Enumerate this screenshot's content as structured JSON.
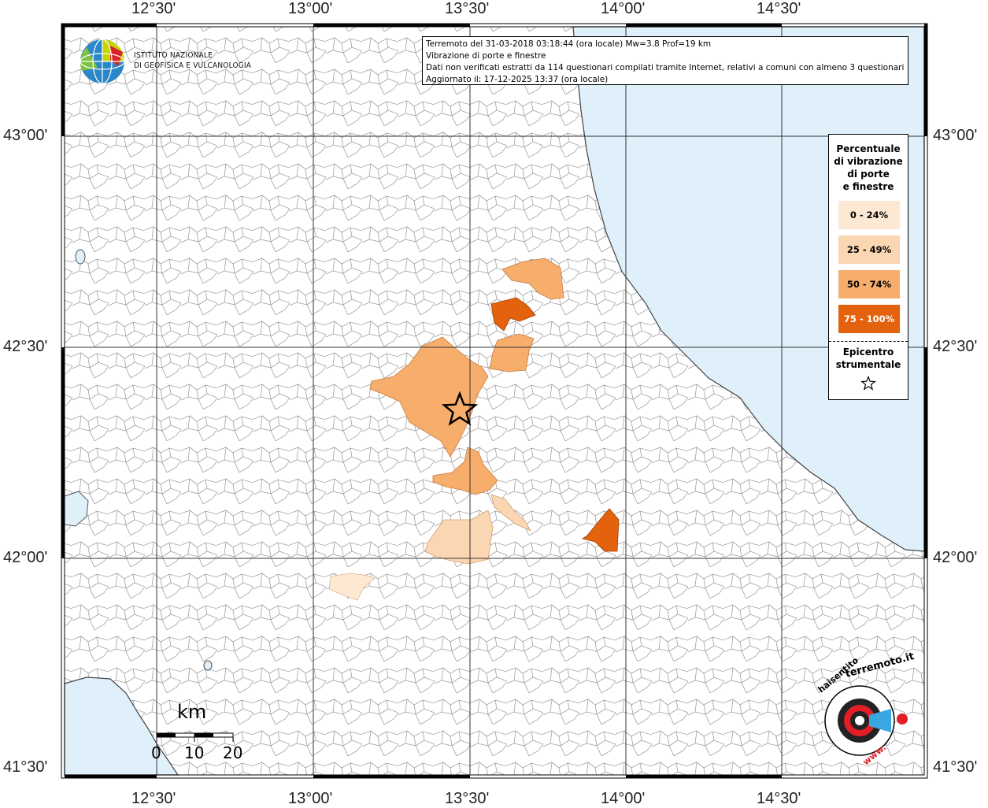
{
  "info": {
    "line1": "Terremoto del 31-03-2018 03:18:44 (ora locale) Mw=3.8 Prof=19 km",
    "line2": "Vibrazione di porte e finestre",
    "line3": "Dati non verificati estratti da 114 questionari compilati tramite Internet, relativi a comuni con almeno 3 questionari.",
    "line4": "Aggiornato il: 17-12-2025 13:37 (ora locale)"
  },
  "logo": {
    "icon": "ingv-globe-icon",
    "line1": "ISTITUTO NAZIONALE",
    "line2": "DI GEOFISICA E VULCANOLOGIA"
  },
  "axes": {
    "top": [
      "12°30'",
      "13°00'",
      "13°30'",
      "14°00'",
      "14°30'"
    ],
    "bottom": [
      "12°30'",
      "13°00'",
      "13°30'",
      "14°00'",
      "14°30'"
    ],
    "left": [
      "43°00'",
      "42°30'",
      "42°00'",
      "41°30'"
    ],
    "right": [
      "43°00'",
      "42°30'",
      "42°00'",
      "41°30'"
    ]
  },
  "legend": {
    "title": [
      "Percentuale",
      "di vibrazione",
      "di porte",
      "e finestre"
    ],
    "classes": [
      {
        "label": "0 - 24%",
        "color": "#fde9d3",
        "text_color": "#000000"
      },
      {
        "label": "25 - 49%",
        "color": "#fbd6b2",
        "text_color": "#000000"
      },
      {
        "label": "50 - 74%",
        "color": "#f7ae6d",
        "text_color": "#000000"
      },
      {
        "label": "75 - 100%",
        "color": "#e4620d",
        "text_color": "#ffffff"
      }
    ],
    "epicenter_title": [
      "Epicentro",
      "strumentale"
    ],
    "epicenter_icon": "star-icon"
  },
  "scale": {
    "title": "km",
    "labels": [
      "0",
      "10",
      "20"
    ]
  },
  "site_logo": {
    "icon": "sentito-terremoto-logo-icon",
    "text": "haisentitoilterremoto.it"
  },
  "colors": {
    "sea": "#dff0fb",
    "boundary": "#9a9a9a",
    "grid": "#333333"
  }
}
